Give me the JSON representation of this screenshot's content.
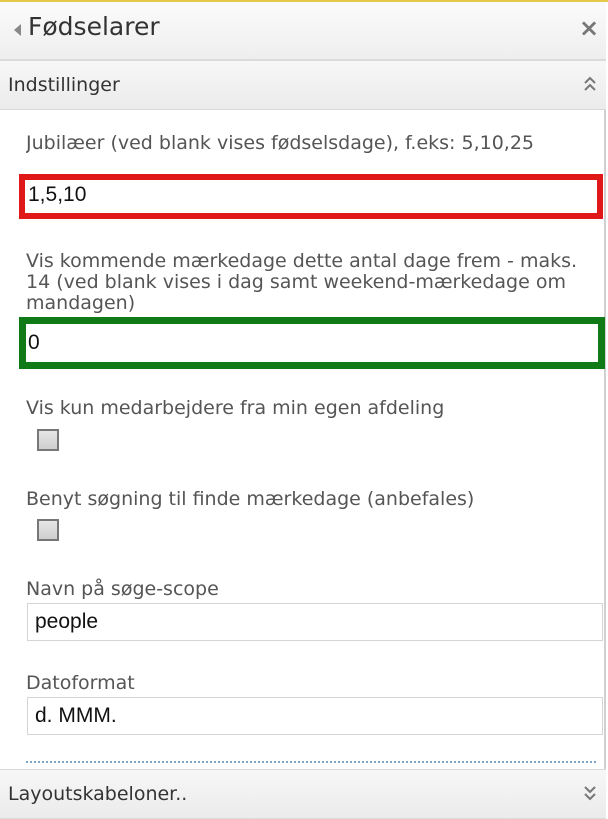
{
  "panel": {
    "title": "Fødselarer",
    "close_icon": "close-icon",
    "collapse_icon": "collapse-left-icon"
  },
  "settings_section": {
    "title": "Indstillinger",
    "toggle_icon": "chevron-up-double-icon"
  },
  "fields": {
    "jubilees": {
      "label": "Jubilæer (ved blank vises fødselsdage), f.eks: 5,10,25",
      "value": "1,5,10"
    },
    "upcoming_days": {
      "label": "Vis kommende mærkedage dette antal dage frem - maks. 14 (ved blank vises i dag samt weekend-mærkedage om mandagen)",
      "value": "0"
    },
    "own_department": {
      "label": "Vis kun medarbejdere fra min egen afdeling",
      "checked": false
    },
    "use_search": {
      "label": "Benyt søgning til finde mærkedage (anbefales)",
      "checked": false
    },
    "search_scope": {
      "label": "Navn på søge-scope",
      "value": "people"
    },
    "date_format": {
      "label": "Datoformat",
      "value": "d. MMM."
    }
  },
  "layout_section": {
    "title": "Layoutskabeloner..",
    "toggle_icon": "chevron-down-double-icon"
  },
  "colors": {
    "highlight_red": "#e01818",
    "highlight_green": "#0f7a16",
    "top_accent": "#e8c84a"
  }
}
